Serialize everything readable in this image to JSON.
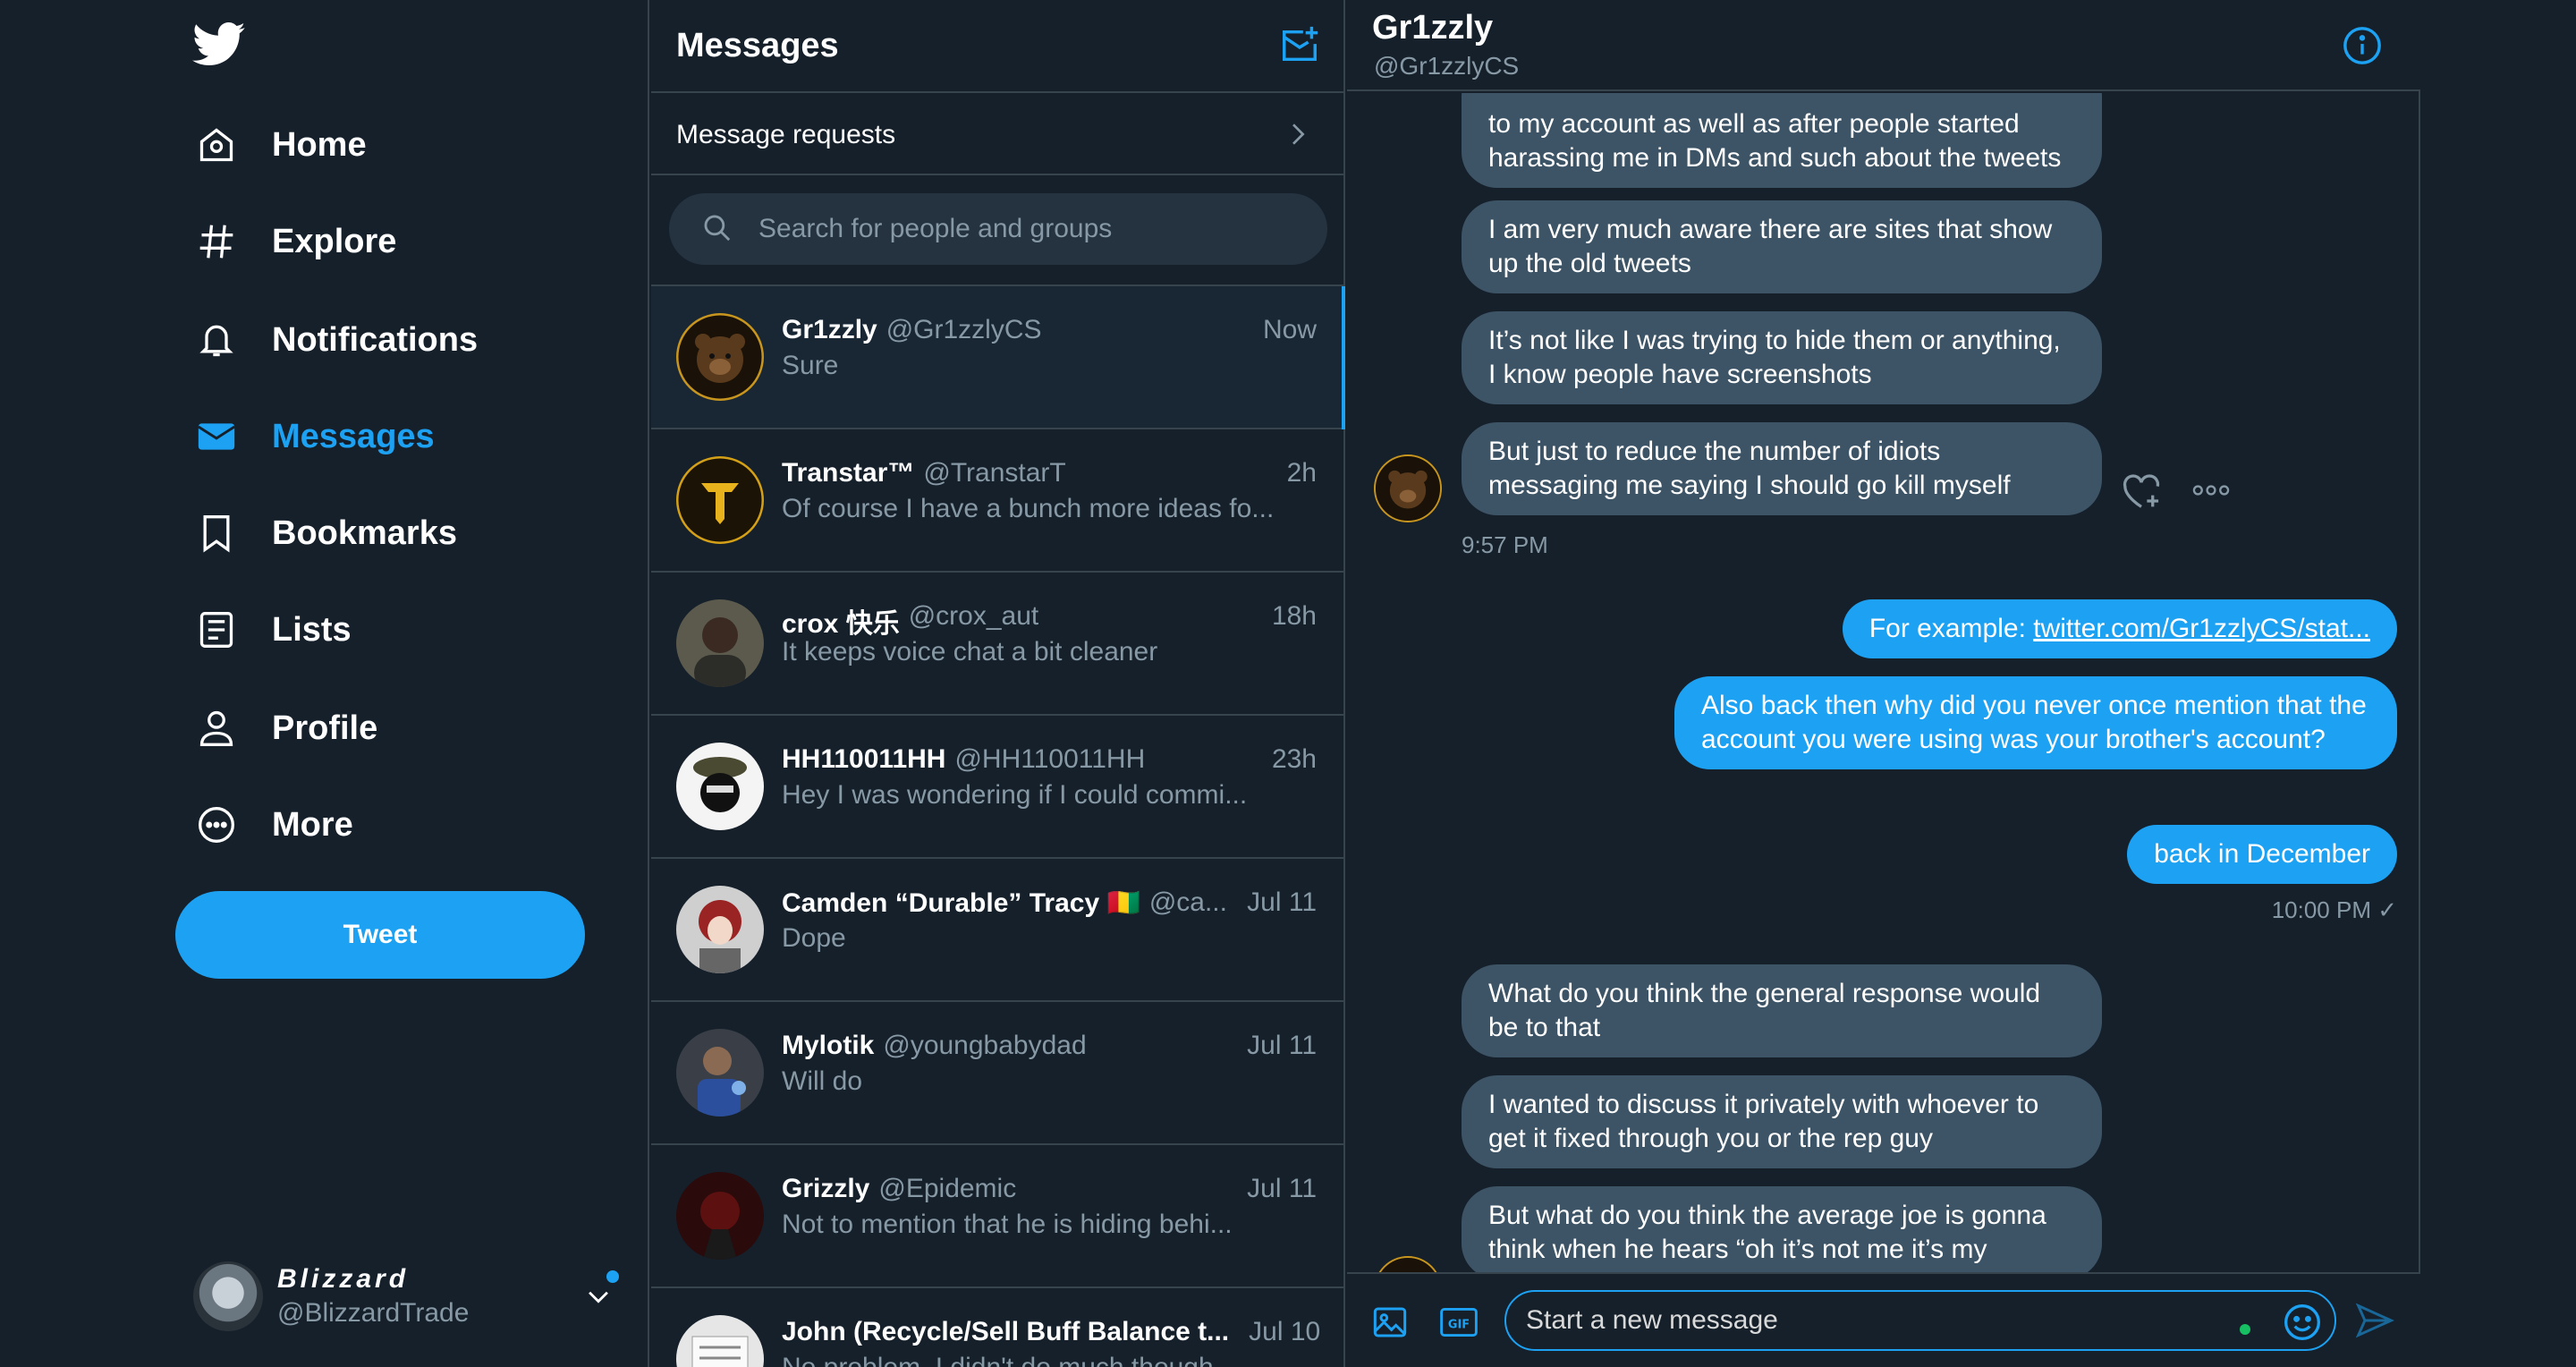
{
  "nav": {
    "items": [
      {
        "label": "Home",
        "icon": "home-icon"
      },
      {
        "label": "Explore",
        "icon": "hashtag-icon"
      },
      {
        "label": "Notifications",
        "icon": "bell-icon"
      },
      {
        "label": "Messages",
        "icon": "envelope-icon"
      },
      {
        "label": "Bookmarks",
        "icon": "bookmark-icon"
      },
      {
        "label": "Lists",
        "icon": "list-icon"
      },
      {
        "label": "Profile",
        "icon": "person-icon"
      },
      {
        "label": "More",
        "icon": "more-circle-icon"
      }
    ],
    "active": "Messages",
    "tweet_label": "Tweet",
    "account": {
      "display_name": "Blizzard",
      "username": "@BlizzardTrade"
    }
  },
  "list": {
    "title": "Messages",
    "requests_label": "Message requests",
    "search_placeholder": "Search for people and groups",
    "conversations": [
      {
        "name": "Gr1zzly",
        "handle": "@Gr1zzlyCS",
        "time": "Now",
        "preview": "Sure"
      },
      {
        "name": "Transtar™",
        "handle": "@TranstarT",
        "time": "2h",
        "preview": "Of course I have a bunch more ideas fo..."
      },
      {
        "name": "crox 快乐",
        "handle": "@crox_aut",
        "time": "18h",
        "preview": "It keeps voice chat a bit cleaner"
      },
      {
        "name": "HH110011HH",
        "handle": "@HH110011HH",
        "time": "23h",
        "preview": "Hey I was wondering if I could commi..."
      },
      {
        "name": "Camden “Durable” Tracy 🇬🇳",
        "handle": "@ca...",
        "time": "Jul 11",
        "preview": "Dope"
      },
      {
        "name": "Mylotik",
        "handle": "@youngbabydad",
        "time": "Jul 11",
        "preview": "Will do"
      },
      {
        "name": "Grizzly",
        "handle": "@Epidemic",
        "time": "Jul 11",
        "preview": "Not to mention that he is hiding behi..."
      },
      {
        "name": "John (Recycle/Sell Buff Balance t...",
        "handle": "",
        "time": "Jul 10",
        "preview": "No problem. I didn't do much though"
      }
    ]
  },
  "chat": {
    "name": "Gr1zzly",
    "handle": "@Gr1zzlyCS",
    "messages": {
      "m1": "to my account as well as after people started harassing me in DMs and such about the tweets",
      "m2": "I am very much aware there are sites that show up the old tweets",
      "m3": "It’s not like I was trying to hide them or anything, I know people have screenshots",
      "m4": "But just to reduce the number of idiots messaging me saying I should go kill myself",
      "m4_time": "9:57 PM",
      "o1_prefix": "For example: ",
      "o1_link": "twitter.com/Gr1zzlyCS/stat...",
      "o2": "Also back then why did you never once mention that the account you were using was your brother's account?",
      "o3": "back in December",
      "o3_time": "10:00 PM ✓",
      "m5": "What do you think the general response would be to that",
      "m6": "I wanted to discuss it privately with whoever to get it fixed through you or the rep guy",
      "m7": "But what do you think the average joe is gonna think when he hears “oh it’s not me it’s my"
    },
    "composer_placeholder": "Start a new message"
  },
  "colors": {
    "accent": "#1da1f2",
    "background": "#15202b",
    "bubble_in": "#3d5466",
    "muted": "#8899a6"
  }
}
